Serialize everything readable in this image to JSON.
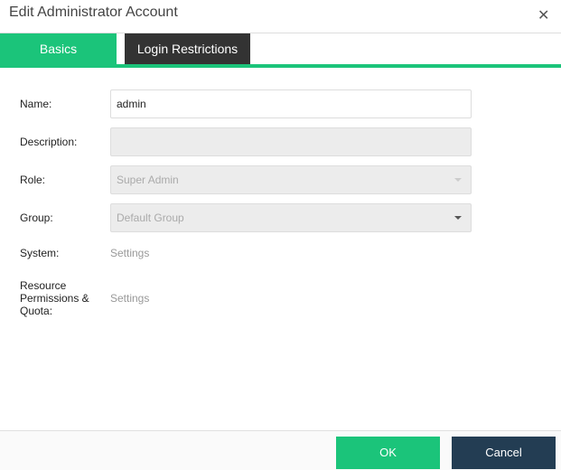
{
  "dialog": {
    "title": "Edit Administrator Account",
    "close_icon": "close-icon"
  },
  "tabs": [
    {
      "label": "Basics",
      "active": true
    },
    {
      "label": "Login Restrictions",
      "active": false
    }
  ],
  "form": {
    "name": {
      "label": "Name:",
      "value": "admin"
    },
    "description": {
      "label": "Description:",
      "value": ""
    },
    "role": {
      "label": "Role:",
      "value": "Super Admin"
    },
    "group": {
      "label": "Group:",
      "value": "Default Group"
    },
    "system": {
      "label": "System:",
      "link": "Settings"
    },
    "resource": {
      "label": "Resource Permissions & Quota:",
      "link": "Settings"
    }
  },
  "footer": {
    "ok": "OK",
    "cancel": "Cancel"
  },
  "colors": {
    "accent": "#1bc47a",
    "cancel": "#233d53",
    "tab_inactive": "#333333"
  }
}
